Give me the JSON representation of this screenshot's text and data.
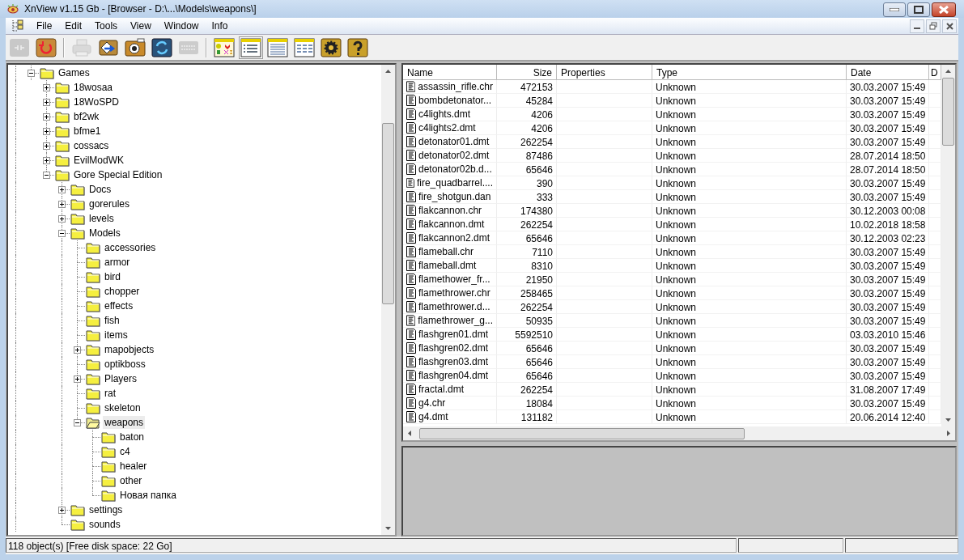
{
  "window": {
    "title": "XnView v1.15 Gb - [Browser - D:\\...\\Models\\weapons\\]"
  },
  "menu": [
    "File",
    "Edit",
    "Tools",
    "View",
    "Window",
    "Info"
  ],
  "toolbar": [
    {
      "kind": "connect",
      "disabled": true,
      "selected": false
    },
    {
      "kind": "refresh",
      "disabled": false,
      "selected": false
    },
    {
      "kind": "separator"
    },
    {
      "kind": "print",
      "disabled": true,
      "selected": false
    },
    {
      "kind": "convert",
      "disabled": false,
      "selected": false
    },
    {
      "kind": "capture",
      "disabled": false,
      "selected": false
    },
    {
      "kind": "sync",
      "disabled": false,
      "selected": false
    },
    {
      "kind": "html",
      "disabled": true,
      "selected": false
    },
    {
      "kind": "separator"
    },
    {
      "kind": "thumbnails",
      "disabled": false,
      "selected": false
    },
    {
      "kind": "details",
      "disabled": false,
      "selected": true
    },
    {
      "kind": "list",
      "disabled": false,
      "selected": false
    },
    {
      "kind": "report",
      "disabled": false,
      "selected": false
    },
    {
      "kind": "settings",
      "disabled": false,
      "selected": false
    },
    {
      "kind": "help",
      "disabled": false,
      "selected": false
    }
  ],
  "tree": [
    {
      "label": "Games",
      "expanded": true,
      "selected": false,
      "children": [
        {
          "label": "18wosaa",
          "expanded": false,
          "selected": false
        },
        {
          "label": "18WoSPD",
          "expanded": false,
          "selected": false
        },
        {
          "label": "bf2wk",
          "expanded": false,
          "selected": false
        },
        {
          "label": "bfme1",
          "expanded": false,
          "selected": false
        },
        {
          "label": "cossacs",
          "expanded": false,
          "selected": false
        },
        {
          "label": "EvilModWK",
          "expanded": false,
          "selected": false
        },
        {
          "label": "Gore Special Edition",
          "expanded": true,
          "selected": false,
          "children": [
            {
              "label": "Docs",
              "expanded": false,
              "selected": false
            },
            {
              "label": "gorerules",
              "expanded": false,
              "selected": false
            },
            {
              "label": "levels",
              "expanded": false,
              "selected": false
            },
            {
              "label": "Models",
              "expanded": true,
              "selected": false,
              "children": [
                {
                  "label": "accessories",
                  "selected": false
                },
                {
                  "label": "armor",
                  "selected": false
                },
                {
                  "label": "bird",
                  "selected": false
                },
                {
                  "label": "chopper",
                  "selected": false
                },
                {
                  "label": "effects",
                  "selected": false
                },
                {
                  "label": "fish",
                  "selected": false
                },
                {
                  "label": "items",
                  "selected": false
                },
                {
                  "label": "mapobjects",
                  "expanded": false,
                  "selected": false
                },
                {
                  "label": "optikboss",
                  "selected": false
                },
                {
                  "label": "Players",
                  "expanded": false,
                  "selected": false
                },
                {
                  "label": "rat",
                  "selected": false
                },
                {
                  "label": "skeleton",
                  "selected": false
                },
                {
                  "label": "weapons",
                  "expanded": true,
                  "selected": true,
                  "children": [
                    {
                      "label": "baton",
                      "selected": false
                    },
                    {
                      "label": "c4",
                      "selected": false
                    },
                    {
                      "label": "healer",
                      "selected": false
                    },
                    {
                      "label": "other",
                      "selected": false
                    },
                    {
                      "label": "Новая папка",
                      "selected": false
                    }
                  ]
                }
              ]
            },
            {
              "label": "settings",
              "expanded": false,
              "selected": false
            },
            {
              "label": "sounds",
              "selected": false
            }
          ]
        }
      ]
    }
  ],
  "files": {
    "columns": [
      "Name",
      "Size",
      "Properties",
      "Type",
      "Date",
      "D"
    ],
    "rows": [
      [
        "assassin_rifle.chr",
        "472153",
        "",
        "Unknown",
        "30.03.2007 15:49",
        ""
      ],
      [
        "bombdetonator...",
        "45284",
        "",
        "Unknown",
        "30.03.2007 15:49",
        ""
      ],
      [
        "c4lights.dmt",
        "4206",
        "",
        "Unknown",
        "30.03.2007 15:49",
        ""
      ],
      [
        "c4lights2.dmt",
        "4206",
        "",
        "Unknown",
        "30.03.2007 15:49",
        ""
      ],
      [
        "detonator01.dmt",
        "262254",
        "",
        "Unknown",
        "30.03.2007 15:49",
        ""
      ],
      [
        "detonator02.dmt",
        "87486",
        "",
        "Unknown",
        "28.07.2014 18:50",
        ""
      ],
      [
        "detonator02b.d...",
        "65646",
        "",
        "Unknown",
        "28.07.2014 18:50",
        ""
      ],
      [
        "fire_quadbarrel....",
        "390",
        "",
        "Unknown",
        "30.03.2007 15:49",
        ""
      ],
      [
        "fire_shotgun.dan",
        "333",
        "",
        "Unknown",
        "30.03.2007 15:49",
        ""
      ],
      [
        "flakcannon.chr",
        "174380",
        "",
        "Unknown",
        "30.12.2003 00:08",
        ""
      ],
      [
        "flakcannon.dmt",
        "262254",
        "",
        "Unknown",
        "10.02.2018 18:58",
        ""
      ],
      [
        "flakcannon2.dmt",
        "65646",
        "",
        "Unknown",
        "30.12.2003 02:23",
        ""
      ],
      [
        "flameball.chr",
        "7110",
        "",
        "Unknown",
        "30.03.2007 15:49",
        ""
      ],
      [
        "flameball.dmt",
        "8310",
        "",
        "Unknown",
        "30.03.2007 15:49",
        ""
      ],
      [
        "flamethower_fr...",
        "21950",
        "",
        "Unknown",
        "30.03.2007 15:49",
        ""
      ],
      [
        "flamethrower.chr",
        "258465",
        "",
        "Unknown",
        "30.03.2007 15:49",
        ""
      ],
      [
        "flamethrower.d...",
        "262254",
        "",
        "Unknown",
        "30.03.2007 15:49",
        ""
      ],
      [
        "flamethrower_g...",
        "50935",
        "",
        "Unknown",
        "30.03.2007 15:49",
        ""
      ],
      [
        "flashgren01.dmt",
        "5592510",
        "",
        "Unknown",
        "03.03.2010 15:46",
        ""
      ],
      [
        "flashgren02.dmt",
        "65646",
        "",
        "Unknown",
        "30.03.2007 15:49",
        ""
      ],
      [
        "flashgren03.dmt",
        "65646",
        "",
        "Unknown",
        "30.03.2007 15:49",
        ""
      ],
      [
        "flashgren04.dmt",
        "65646",
        "",
        "Unknown",
        "30.03.2007 15:49",
        ""
      ],
      [
        "fractal.dmt",
        "262254",
        "",
        "Unknown",
        "31.08.2007 17:49",
        ""
      ],
      [
        "g4.chr",
        "18084",
        "",
        "Unknown",
        "30.03.2007 15:49",
        ""
      ],
      [
        "g4.dmt",
        "131182",
        "",
        "Unknown",
        "20.06.2014 12:40",
        ""
      ]
    ]
  },
  "status_bar": "118 object(s) [Free disk space: 22 Go]"
}
